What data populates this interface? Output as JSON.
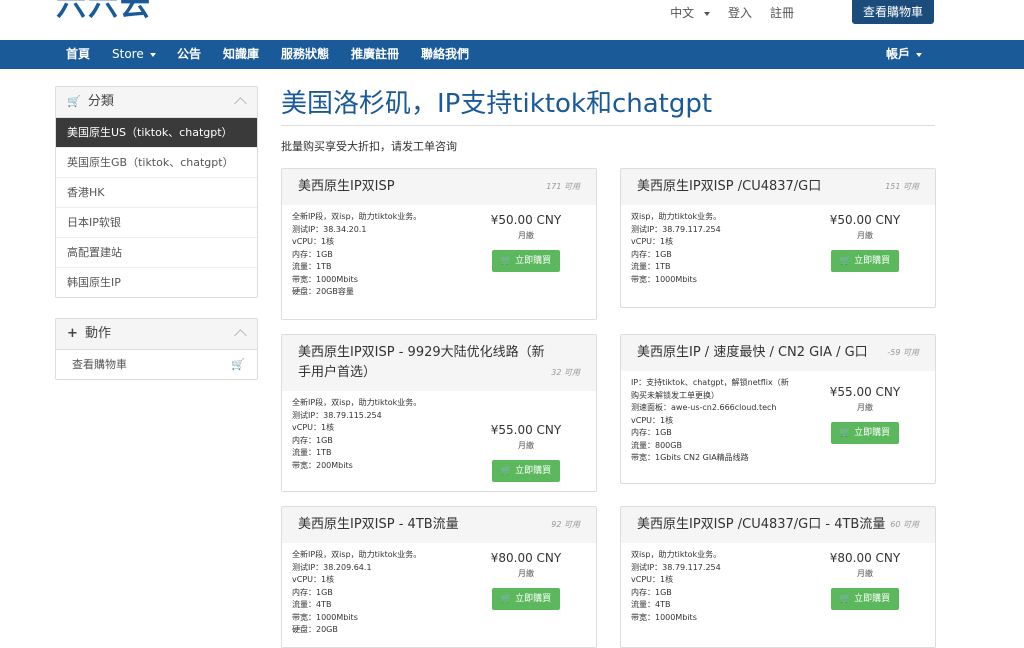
{
  "header": {
    "logo": "六六云",
    "lang": "中文",
    "login": "登入",
    "register": "註冊",
    "cart_button": "查看購物車"
  },
  "nav": {
    "items": [
      "首頁",
      "Store",
      "公告",
      "知識庫",
      "服務狀態",
      "推廣註冊",
      "聯絡我們"
    ],
    "account": "帳戶"
  },
  "sidebar": {
    "categories_title": "分類",
    "categories": [
      "美国原生US（tiktok、chatgpt）",
      "英国原生GB（tiktok、chatgpt）",
      "香港HK",
      "日本IP软银",
      "高配置建站",
      "韩国原生IP"
    ],
    "actions_title": "動作",
    "actions": [
      "查看購物車"
    ]
  },
  "main": {
    "title": "美国洛杉矶，IP支持tiktok和chatgpt",
    "subtitle": "批量购买享受大折扣，请发工单咨询",
    "products": [
      {
        "name": "美西原生IP双ISP",
        "qty": "171 可用",
        "desc": [
          "全新IP段，双isp，助力tiktok业务。",
          "测试IP：38.34.20.1",
          "vCPU：1核",
          "内存：1GB",
          "流量：1TB",
          "带宽：1000Mbits",
          "硬盘：20GB容量"
        ],
        "price": "¥50.00 CNY",
        "cycle": "月繳",
        "buy": "立即購買"
      },
      {
        "name": "美西原生IP双ISP /CU4837/G口",
        "qty": "151 可用",
        "desc": [
          "双isp，助力tiktok业务。",
          "测试IP：38.79.117.254",
          "vCPU：1核",
          "内存：1GB",
          "流量：1TB",
          "带宽：1000Mbits"
        ],
        "price": "¥50.00 CNY",
        "cycle": "月繳",
        "buy": "立即購買"
      },
      {
        "name": "美西原生IP双ISP - 9929大陆优化线路（新手用户首选）",
        "qty": "32 可用",
        "desc": [
          "全新IP段，双isp，助力tiktok业务。",
          "测试IP：38.79.115.254",
          "vCPU：1核",
          "内存：1GB",
          "流量：1TB",
          "带宽：200Mbits"
        ],
        "price": "¥55.00 CNY",
        "cycle": "月繳",
        "buy": "立即購買"
      },
      {
        "name": "美西原生IP / 速度最快 / CN2 GIA / G口",
        "qty": "-59 可用",
        "desc": [
          "IP：支持tiktok、chatgpt，解锁netflix（新",
          "购买未解锁发工单更换）",
          "测速面板：awe-us-cn2.666cloud.tech",
          "vCPU：1核",
          "内存：1GB",
          "流量：800GB",
          "带宽：1Gbits CN2 GIA精品线路"
        ],
        "price": "¥55.00 CNY",
        "cycle": "月繳",
        "buy": "立即購買"
      },
      {
        "name": "美西原生IP双ISP - 4TB流量",
        "qty": "92 可用",
        "desc": [
          "全新IP段，双isp，助力tiktok业务。",
          "测试IP：38.209.64.1",
          "vCPU：1核",
          "内存：1GB",
          "流量：4TB",
          "带宽：1000Mbits",
          "硬盘：20GB"
        ],
        "price": "¥80.00 CNY",
        "cycle": "月繳",
        "buy": "立即購買"
      },
      {
        "name": "美西原生IP双ISP /CU4837/G口 - 4TB流量",
        "qty": "60 可用",
        "desc": [
          "双isp，助力tiktok业务。",
          "测试IP：38.79.117.254",
          "vCPU：1核",
          "内存：1GB",
          "流量：4TB",
          "带宽：1000Mbits"
        ],
        "price": "¥80.00 CNY",
        "cycle": "月繳",
        "buy": "立即購買"
      }
    ]
  },
  "colors": {
    "brand": "#1a5a99",
    "buy_button": "#5cb85c",
    "active_sidebar": "#3a3a3a"
  }
}
